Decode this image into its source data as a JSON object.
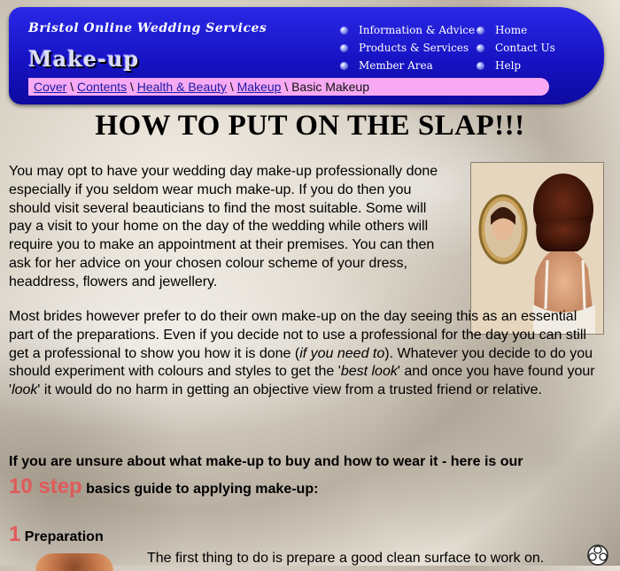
{
  "header": {
    "site_title": "Bristol Online Wedding Services",
    "section_title": "Make-up",
    "nav_left": [
      "Information & Advice",
      "Products & Services",
      "Member Area"
    ],
    "nav_right": [
      "Home",
      "Contact Us",
      "Help"
    ]
  },
  "breadcrumb": {
    "links": [
      "Cover",
      "Contents",
      "Health & Beauty",
      "Makeup"
    ],
    "separator": " \\ ",
    "current": "Basic Makeup"
  },
  "headline": "HOW TO PUT ON THE SLAP!!!",
  "paragraph1": "You may opt to have your wedding day make-up professionally done especially if you seldom wear much make-up. If you do then you should visit several beauticians to find the most suitable. Some will pay a visit to your home on the day of the wedding while others will require you to make an appointment at their premises. You can then ask for her advice on your chosen colour scheme of your dress, headdress, flowers and jewellery.",
  "paragraph2": {
    "part1": "Most brides however prefer to do their own make-up on the day seeing this as an essential part of the preparations. Even if you decide not to use a professional for the day you can still get a professional to show you how it is done (",
    "italic1": "if you need to",
    "part2": "). Whatever you decide to do you should experiment with colours and styles to get the '",
    "italic2": "best look",
    "part3": "' and once you have found your '",
    "italic3": "look",
    "part4": "' it would do no harm in getting an objective view from a trusted friend or relative."
  },
  "intro": {
    "line1": "If you are unsure about what make-up to buy and how to wear it - here is our",
    "highlight": "10 step",
    "line2": " basics guide to applying make-up:"
  },
  "step1": {
    "number": "1",
    "title": " Preparation",
    "text": "The first thing to do is prepare a good clean surface to work on."
  },
  "colors": {
    "header_blue": "#1713c4",
    "breadcrumb_pink": "#f7a9f3",
    "accent_red": "#e05a5a",
    "link_blue": "#1a1aa6"
  }
}
